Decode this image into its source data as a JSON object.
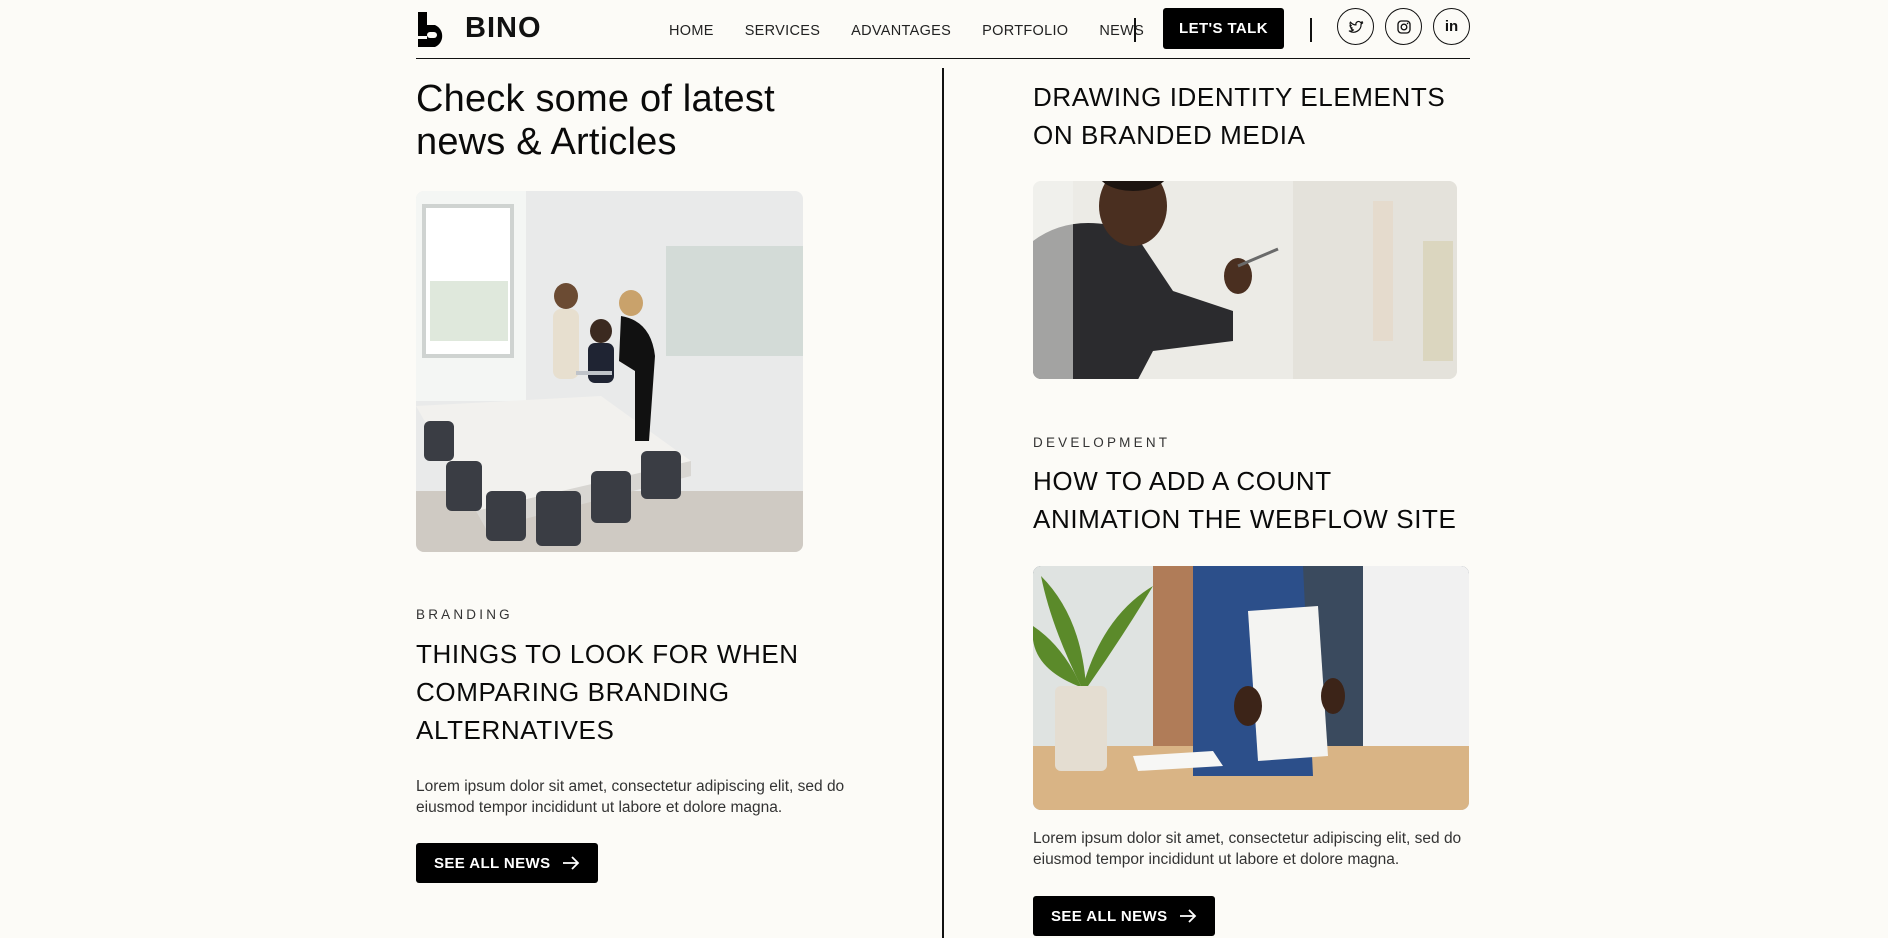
{
  "header": {
    "logo_text": "BINO",
    "nav": [
      "HOME",
      "SERVICES",
      "ADVANTAGES",
      "PORTFOLIO",
      "NEWS"
    ],
    "cta_label": "LET'S TALK",
    "social_icons": [
      "twitter-icon",
      "instagram-icon",
      "linkedin-icon"
    ],
    "linkedin_text": "in"
  },
  "left": {
    "section_title": "Check some of latest news & Articles",
    "post": {
      "category": "BRANDING",
      "title": "THINGS TO LOOK FOR WHEN COMPARING BRANDING ALTERNATIVES",
      "excerpt": "Lorem ipsum dolor sit amet, consectetur adipiscing elit, sed do eiusmod tempor incididunt ut labore et dolore magna.",
      "button_label": "SEE ALL NEWS"
    }
  },
  "right": {
    "posts": [
      {
        "title": "DRAWING IDENTITY ELEMENTS ON BRANDED MEDIA"
      },
      {
        "category": "DEVELOPMENT",
        "title": "HOW TO ADD A COUNT ANIMATION THE WEBFLOW SITE",
        "excerpt": "Lorem ipsum dolor sit amet, consectetur adipiscing elit, sed do eiusmod tempor incididunt ut labore et dolore magna.",
        "button_label": "SEE ALL NEWS"
      }
    ]
  },
  "colors": {
    "background": "#fcfbf7",
    "ink": "#000000",
    "button_text": "#ffffff"
  }
}
